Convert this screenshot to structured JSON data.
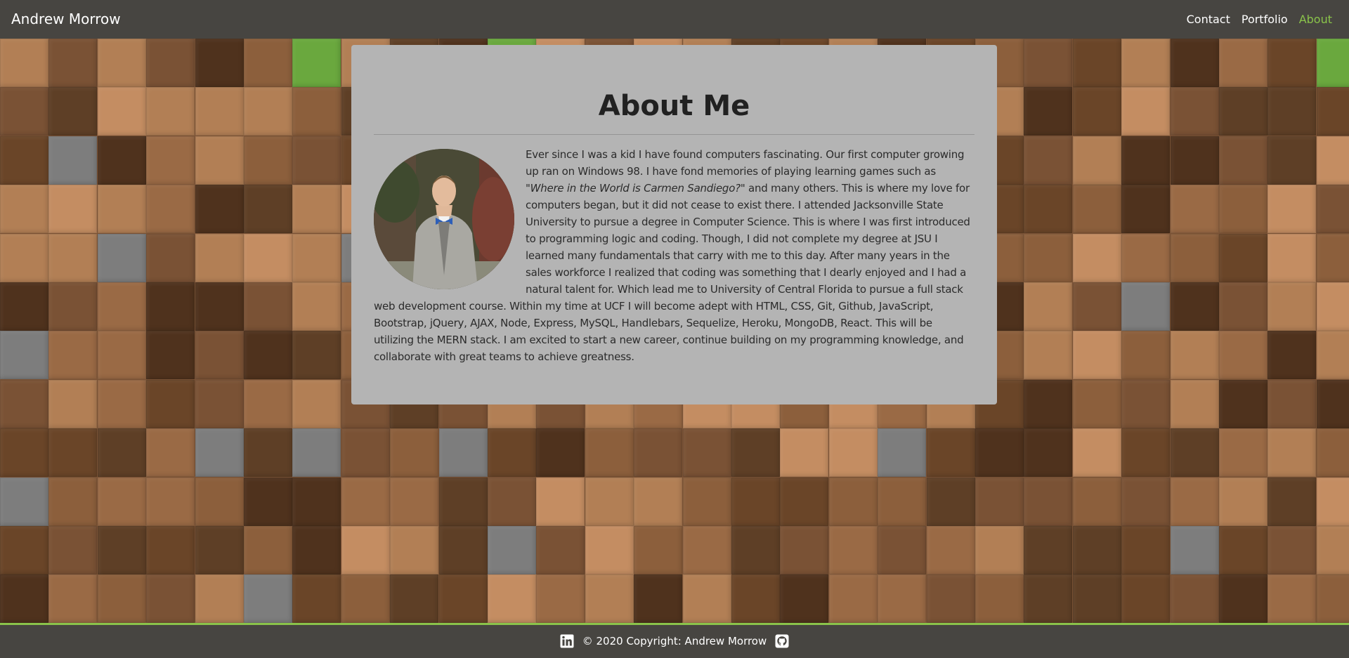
{
  "navbar": {
    "brand": "Andrew Morrow",
    "links": [
      {
        "label": "Contact",
        "active": false
      },
      {
        "label": "Portfolio",
        "active": false
      },
      {
        "label": "About",
        "active": true
      }
    ]
  },
  "about": {
    "title": "About Me",
    "paragraph_before_italic": "Ever since I was a kid I have found computers fascinating. Our first computer growing up ran on Windows 98. I have fond memories of playing learning games such as \"",
    "italic": "Where in the World is Carmen Sandiego?",
    "paragraph_after_italic": "\" and many others. This is where my love for computers began, but it did not cease to exist there. I attended Jacksonville State University to pursue a degree in Computer Science. This is where I was first introduced to programming logic and coding. Though, I did not complete my degree at JSU I learned many fundamentals that carry with me to this day. After many years in the sales workforce I realized that coding was something that I dearly enjoyed and I had a natural talent for. Which lead me to University of Central Florida to pursue a full stack web development course. Within my time at UCF I will become adept with HTML, CSS, Git, Github, JavaScript, Bootstrap, jQuery, AJAX, Node, Express, MySQL, Handlebars, Sequelize, Heroku, MongoDB, React. This will be utilizing the MERN stack. I am excited to start a new career, continue building on my programming knowledge, and collaborate with great teams to achieve greatness."
  },
  "footer": {
    "copyright": "© 2020 Copyright: Andrew Morrow",
    "icons": [
      "linkedin-icon",
      "github-icon"
    ]
  },
  "colors": {
    "navbar_bg": "#474541",
    "accent_green": "#8ac34a",
    "card_bg": "#b4b4b4"
  }
}
